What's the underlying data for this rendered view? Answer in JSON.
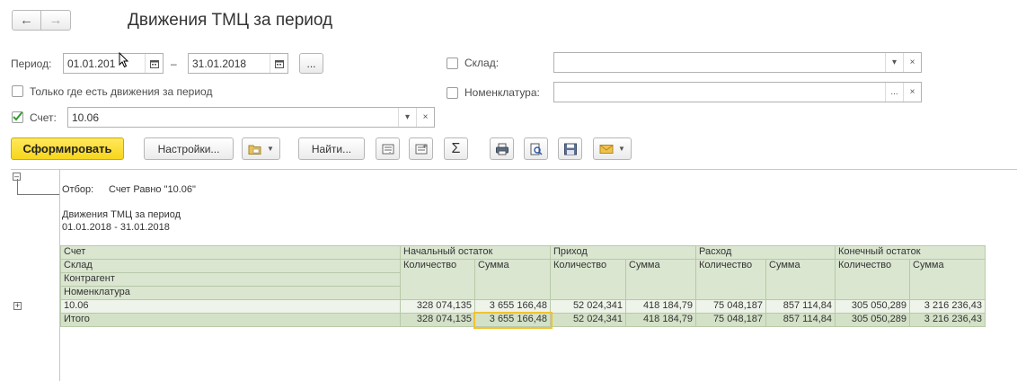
{
  "nav": {
    "back_icon": "←",
    "forward_icon": "→"
  },
  "title": "Движения ТМЦ за период",
  "filters": {
    "period_label": "Период:",
    "date_from": "01.01.201",
    "date_dash": "–",
    "date_to": "31.01.2018",
    "ellipsis": "...",
    "sklad_label": "Склад:",
    "sklad_value": "",
    "only_moves_label": "Только где есть движения за период",
    "nomen_label": "Номенклатура:",
    "nomen_value": "",
    "schet_label": "Счет:",
    "schet_value": "10.06",
    "clear": "×",
    "dropdown": "▾"
  },
  "toolbar": {
    "generate": "Сформировать",
    "settings": "Настройки...",
    "find": "Найти...",
    "sigma": "Σ"
  },
  "report": {
    "filter_label": "Отбор:",
    "filter_value": "Счет Равно \"10.06\"",
    "title": "Движения ТМЦ за период",
    "period": "01.01.2018 - 31.01.2018",
    "headers": {
      "schet": "Счет",
      "sklad": "Склад",
      "kontragent": "Контрагент",
      "nomen": "Номенклатура",
      "start": "Начальный остаток",
      "income": "Приход",
      "expense": "Расход",
      "end": "Конечный остаток",
      "qty": "Количество",
      "sum": "Сумма"
    },
    "rows": [
      {
        "name": "10.06",
        "v": [
          "328 074,135",
          "3 655 166,48",
          "52 024,341",
          "418 184,79",
          "75 048,187",
          "857 114,84",
          "305 050,289",
          "3 216 236,43"
        ]
      },
      {
        "name": "Итого",
        "v": [
          "328 074,135",
          "3 655 166,48",
          "52 024,341",
          "418 184,79",
          "75 048,187",
          "857 114,84",
          "305 050,289",
          "3 216 236,43"
        ]
      }
    ]
  },
  "colors": {
    "accent": "#f7d61a",
    "table_header": "#dae6d0",
    "selection": "#f1c232"
  }
}
